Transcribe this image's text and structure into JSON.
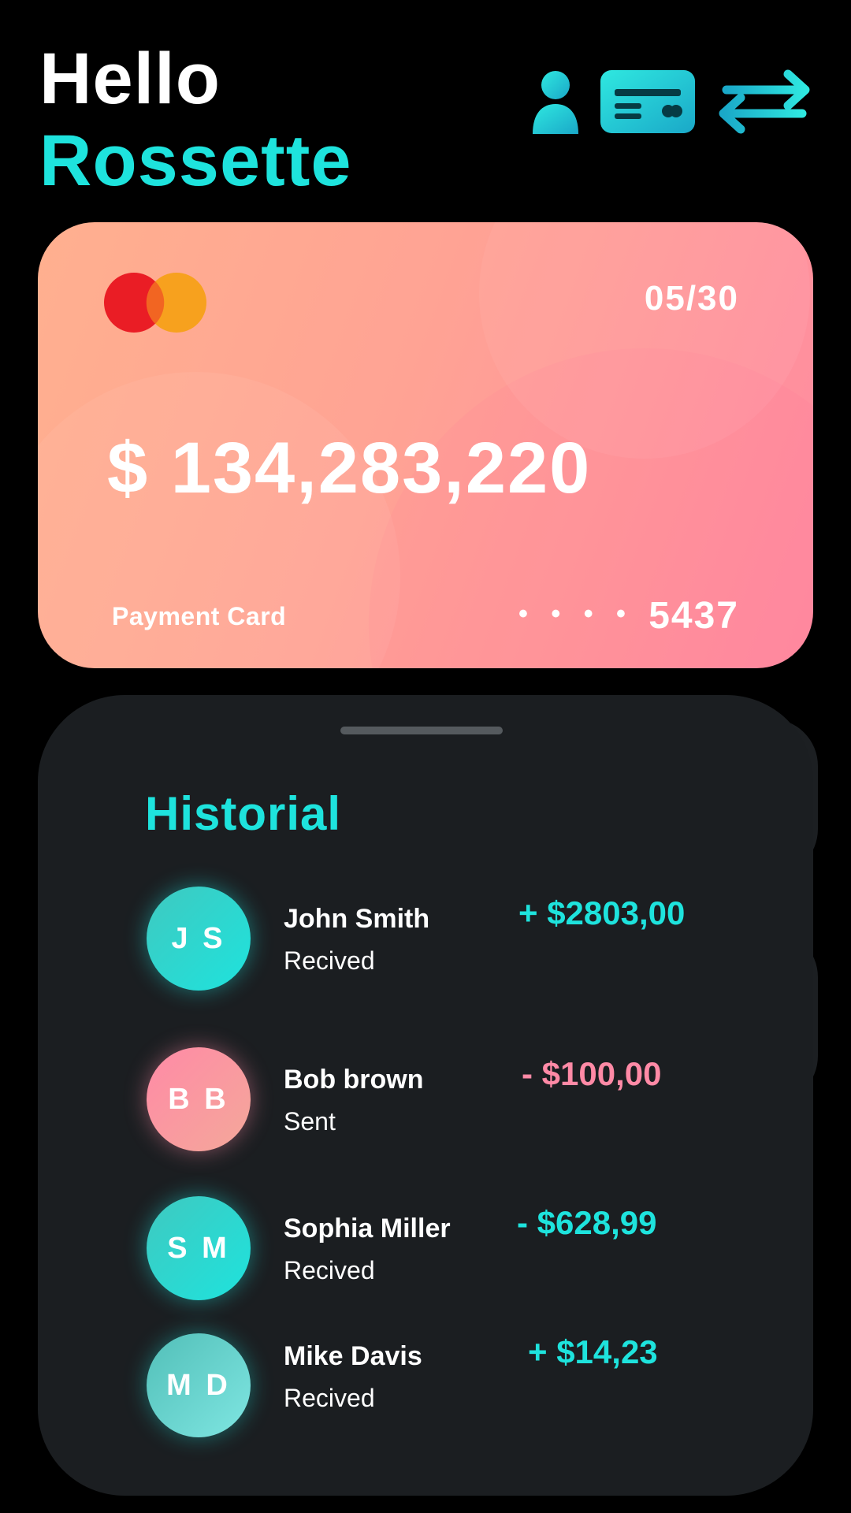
{
  "header": {
    "greeting": "Hello",
    "user_name": "Rossette",
    "icons": [
      "user-icon",
      "credit-card-icon",
      "transfer-arrows-icon"
    ]
  },
  "colors": {
    "accent": "#1ee3dd",
    "negative": "#ff8aa6",
    "background": "#000000",
    "panel": "#1b1e21"
  },
  "card": {
    "brand_icon": "mastercard-logo",
    "expiry": "05/30",
    "balance": "$ 134,283,220",
    "label": "Payment Card",
    "masked": "• • • •",
    "last4": "5437"
  },
  "history": {
    "title": "Historial",
    "transactions": [
      {
        "initials": "J S",
        "name": "John Smith",
        "status": "Recived",
        "amount": "+ $2803,00",
        "amount_color": "#1ee3dd"
      },
      {
        "initials": "B B",
        "name": "Bob brown",
        "status": "Sent",
        "amount": "- $100,00",
        "amount_color": "#ff8aa6"
      },
      {
        "initials": "S M",
        "name": "Sophia Miller",
        "status": "Recived",
        "amount": "- $628,99",
        "amount_color": "#1ee3dd"
      },
      {
        "initials": "M D",
        "name": "Mike Davis",
        "status": "Recived",
        "amount": "+ $14,23",
        "amount_color": "#1ee3dd"
      }
    ]
  }
}
